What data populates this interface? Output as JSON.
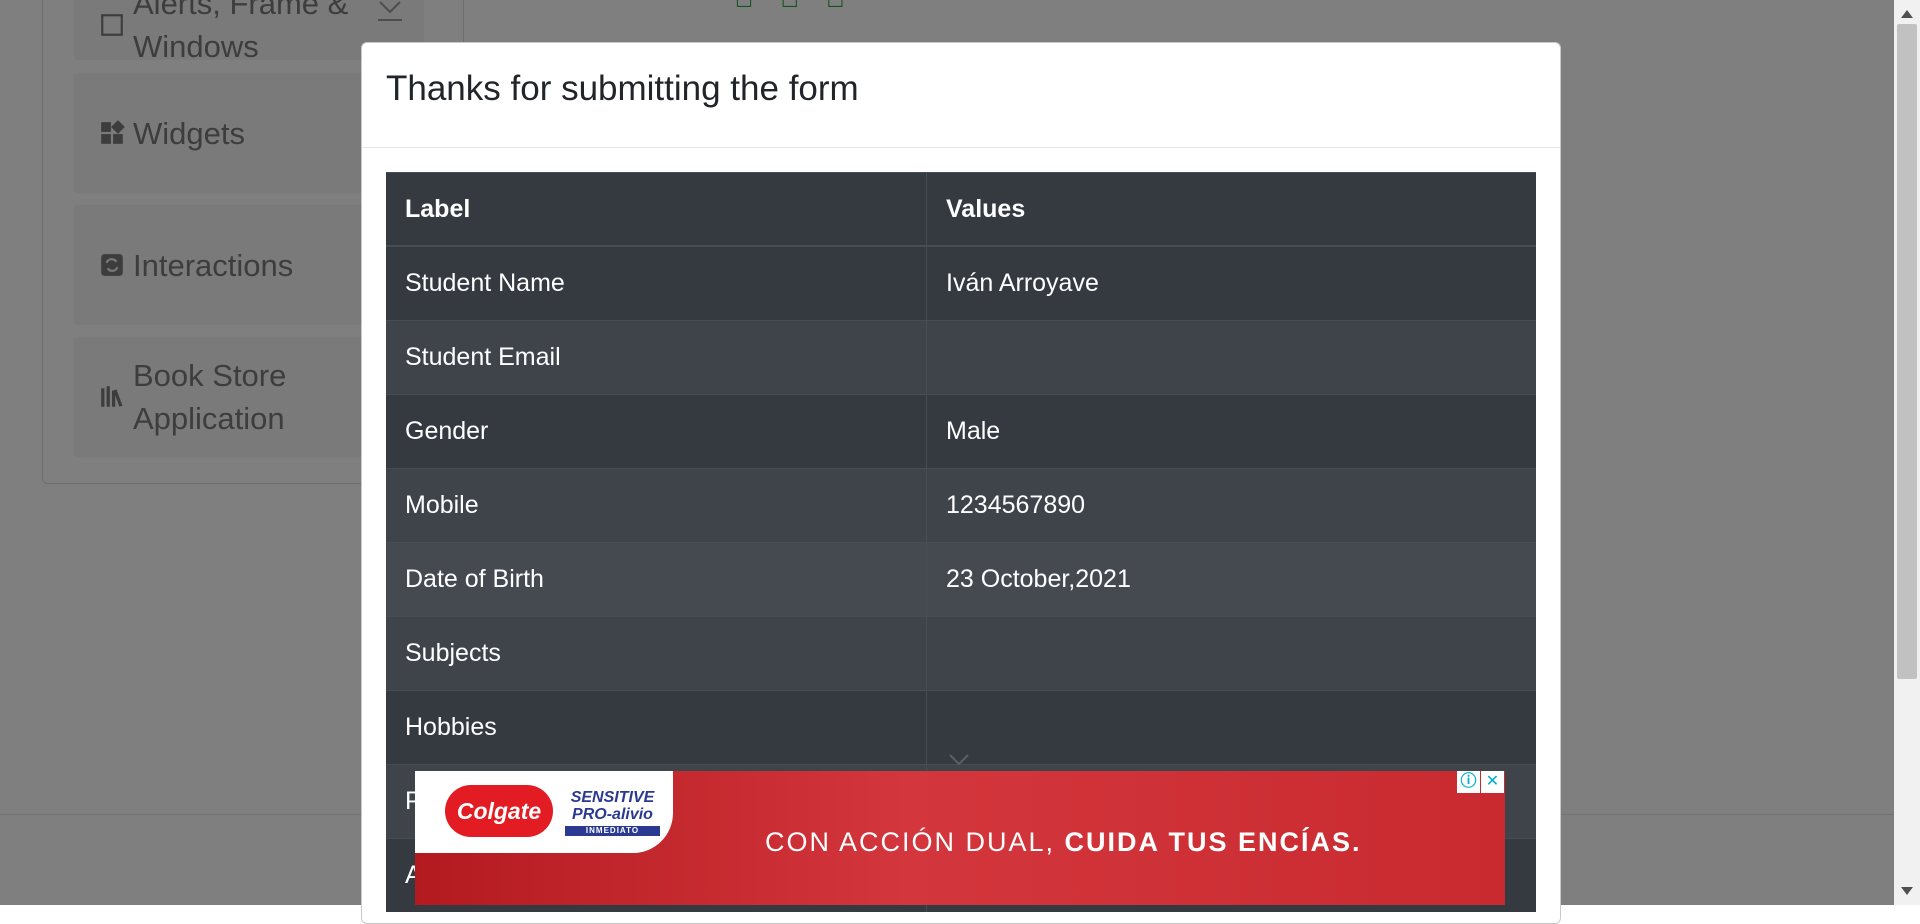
{
  "sidebar": {
    "groups": [
      {
        "label": "Alerts, Frame &\nWindows",
        "icon": "window-icon"
      },
      {
        "label": "Widgets",
        "icon": "widgets-icon"
      },
      {
        "label": "Interactions",
        "icon": "interactions-icon"
      },
      {
        "label": "Book Store\nApplication",
        "icon": "bookstore-icon"
      }
    ]
  },
  "modal": {
    "title": "Thanks for submitting the form",
    "table": {
      "headers": [
        "Label",
        "Values"
      ],
      "rows": [
        {
          "label": "Student Name",
          "value": "Iván Arroyave"
        },
        {
          "label": "Student Email",
          "value": ""
        },
        {
          "label": "Gender",
          "value": "Male"
        },
        {
          "label": "Mobile",
          "value": "1234567890"
        },
        {
          "label": "Date of Birth",
          "value": "23 October,2021"
        },
        {
          "label": "Subjects",
          "value": ""
        },
        {
          "label": "Hobbies",
          "value": ""
        },
        {
          "label": "P",
          "value": ""
        },
        {
          "label": "A",
          "value": ""
        }
      ]
    }
  },
  "ad": {
    "brand": "Colgate",
    "product_line1": "SENSITIVE",
    "product_line2": "PRO-alivio",
    "product_line3": "INMEDIATO",
    "headline_regular": "CON ACCIÓN DUAL, ",
    "headline_bold": "CUIDA TUS ENCÍAS.",
    "info_icon": "ⓘ",
    "close_icon": "✕"
  },
  "colors": {
    "table_dark": "#343a40",
    "table_stripe": "#3e444a",
    "ad_red": "#d3363c",
    "overlay": "rgba(0,0,0,0.5)"
  }
}
